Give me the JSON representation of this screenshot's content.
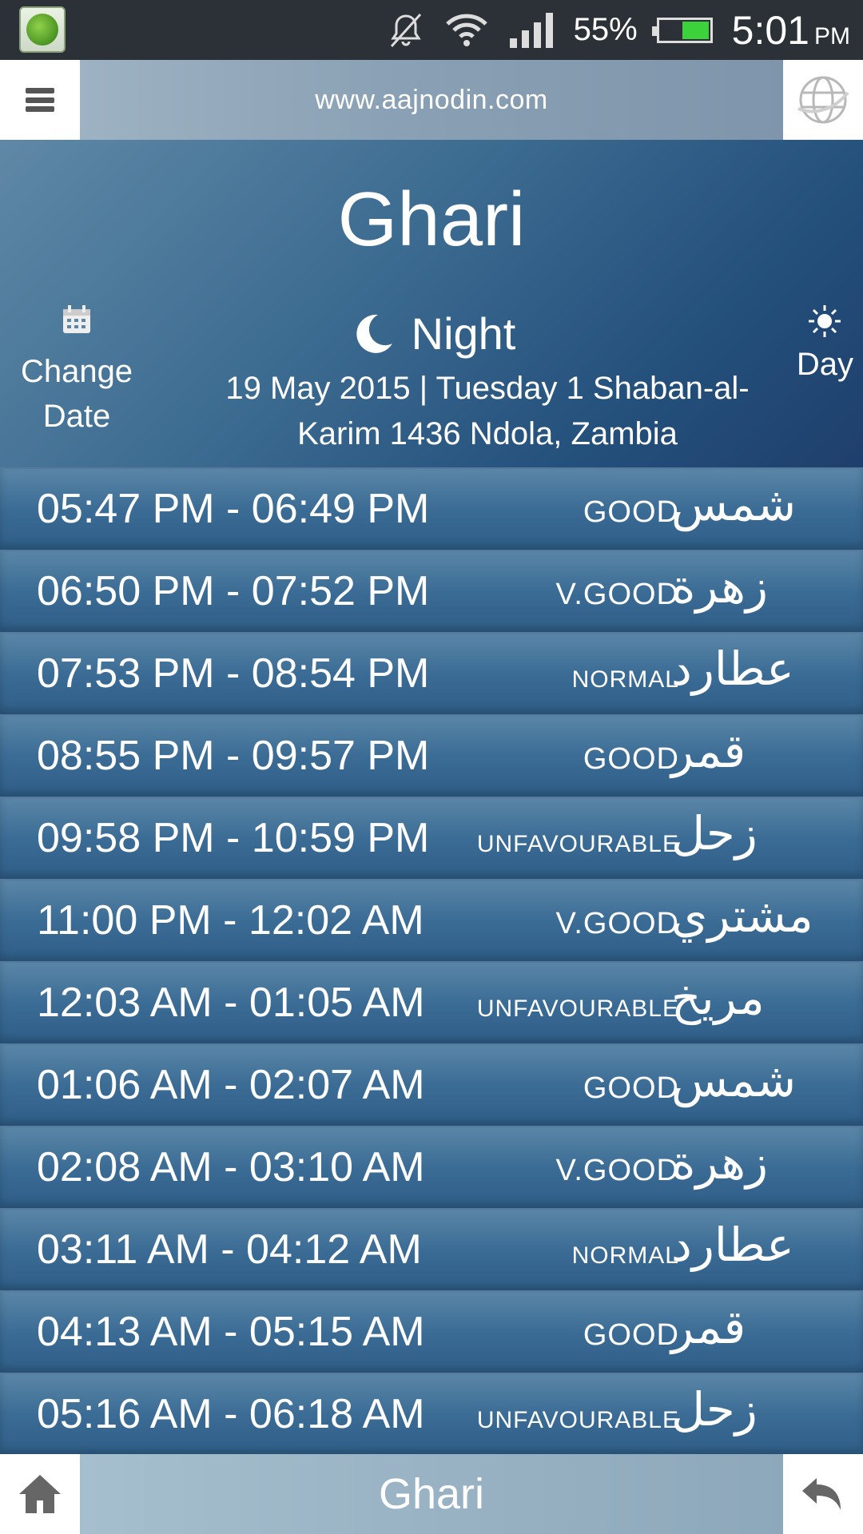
{
  "status_bar": {
    "battery_percent": "55%",
    "battery_level": 0.55,
    "time": "5:01",
    "time_suffix": "PM"
  },
  "top_bar": {
    "url": "www.aajnodin.com"
  },
  "header": {
    "title": "Ghari",
    "change_date_line1": "Change",
    "change_date_line2": "Date",
    "mode": "Night",
    "day_label": "Day",
    "date_line1": "19 May 2015 | Tuesday 1 Shaban-al-",
    "date_line2": "Karim 1436 Ndola, Zambia"
  },
  "rows": [
    {
      "time": "05:47 PM - 06:49 PM",
      "rating": "GOOD",
      "arabic": "شمس"
    },
    {
      "time": "06:50 PM - 07:52 PM",
      "rating": "V.GOOD",
      "arabic": "زهرة"
    },
    {
      "time": "07:53 PM - 08:54 PM",
      "rating": "NORMAL",
      "arabic": "عطارد"
    },
    {
      "time": "08:55 PM - 09:57 PM",
      "rating": "GOOD",
      "arabic": "قمر"
    },
    {
      "time": "09:58 PM - 10:59 PM",
      "rating": "UNFAVOURABLE",
      "arabic": "زحل"
    },
    {
      "time": "11:00 PM - 12:02 AM",
      "rating": "V.GOOD",
      "arabic": "مشتري"
    },
    {
      "time": "12:03 AM - 01:05 AM",
      "rating": "UNFAVOURABLE",
      "arabic": "مريخ"
    },
    {
      "time": "01:06 AM - 02:07 AM",
      "rating": "GOOD",
      "arabic": "شمس"
    },
    {
      "time": "02:08 AM - 03:10 AM",
      "rating": "V.GOOD",
      "arabic": "زهرة"
    },
    {
      "time": "03:11 AM - 04:12 AM",
      "rating": "NORMAL",
      "arabic": "عطارد"
    },
    {
      "time": "04:13 AM - 05:15 AM",
      "rating": "GOOD",
      "arabic": "قمر"
    },
    {
      "time": "05:16 AM - 06:18 AM",
      "rating": "UNFAVOURABLE",
      "arabic": "زحل"
    }
  ],
  "bottom_bar": {
    "label": "Ghari"
  },
  "icons": {
    "app": "app-logo-icon",
    "mute": "bell-muted-icon",
    "wifi": "wifi-icon",
    "signal": "signal-icon",
    "battery": "battery-icon",
    "menu": "hamburger-menu-icon",
    "globe": "globe-icon",
    "calendar": "calendar-icon",
    "moon": "crescent-moon-icon",
    "sun": "sun-icon",
    "home": "home-icon",
    "back": "back-arrow-icon"
  }
}
